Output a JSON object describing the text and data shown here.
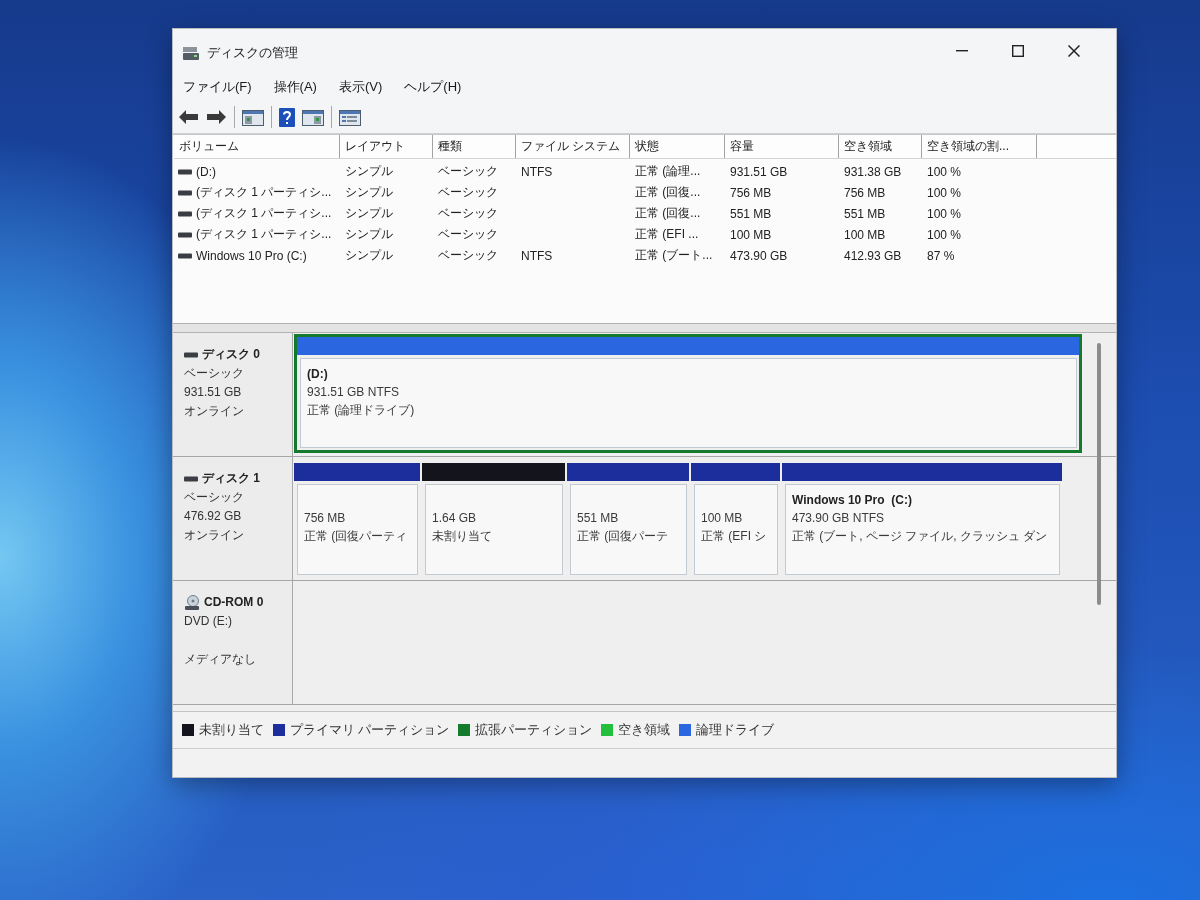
{
  "window": {
    "title": "ディスクの管理"
  },
  "menu": [
    {
      "label": "ファイル(F)"
    },
    {
      "label": "操作(A)"
    },
    {
      "label": "表示(V)"
    },
    {
      "label": "ヘルプ(H)"
    }
  ],
  "volume_table": {
    "columns": [
      "ボリューム",
      "レイアウト",
      "種類",
      "ファイル システム",
      "状態",
      "容量",
      "空き領域",
      "空き領域の割..."
    ],
    "rows": [
      {
        "volume": "(D:)",
        "layout": "シンプル",
        "type": "ベーシック",
        "file_system": "NTFS",
        "status": "正常 (論理...",
        "capacity": "931.51 GB",
        "free_space": "931.38 GB",
        "percent_free": "100 %"
      },
      {
        "volume": "(ディスク 1 パーティシ...",
        "layout": "シンプル",
        "type": "ベーシック",
        "status": "正常 (回復...",
        "capacity": "756 MB",
        "free_space": "756 MB",
        "percent_free": "100 %"
      },
      {
        "volume": "(ディスク 1 パーティシ...",
        "layout": "シンプル",
        "type": "ベーシック",
        "status": "正常 (回復...",
        "capacity": "551 MB",
        "free_space": "551 MB",
        "percent_free": "100 %"
      },
      {
        "volume": "(ディスク 1 パーティシ...",
        "layout": "シンプル",
        "type": "ベーシック",
        "status": "正常 (EFI ...",
        "capacity": "100 MB",
        "free_space": "100 MB",
        "percent_free": "100 %"
      },
      {
        "volume": "Windows 10 Pro (C:)",
        "layout": "シンプル",
        "type": "ベーシック",
        "file_system": "NTFS",
        "status": "正常 (ブート...",
        "capacity": "473.90 GB",
        "free_space": "412.93 GB",
        "percent_free": "87 %"
      }
    ]
  },
  "disks": [
    {
      "kind": "disk",
      "name": "ディスク 0",
      "type": "ベーシック",
      "size": "931.51 GB",
      "status": "オンライン",
      "partitions": [
        {
          "kind": "extended",
          "partitions": [
            {
              "kind": "logical",
              "label": "(D:)",
              "size": "931.51 GB NTFS",
              "status": "正常 (論理ドライブ)"
            }
          ]
        }
      ]
    },
    {
      "kind": "disk",
      "name": "ディスク 1",
      "type": "ベーシック",
      "size": "476.92 GB",
      "status": "オンライン",
      "partitions": [
        {
          "kind": "primary",
          "size": "756 MB",
          "status": "正常 (回復パーティ"
        },
        {
          "kind": "unallocated",
          "size": "1.64 GB",
          "status": "未割り当て"
        },
        {
          "kind": "primary",
          "size": "551 MB",
          "status": "正常 (回復パーテ"
        },
        {
          "kind": "primary",
          "size": "100 MB",
          "status": "正常 (EFI シ"
        },
        {
          "kind": "primary",
          "label": "Windows 10 Pro  (C:)",
          "size": "473.90 GB NTFS",
          "status": "正常 (ブート, ページ ファイル, クラッシュ ダン"
        }
      ]
    },
    {
      "kind": "cdrom",
      "name": "CD-ROM 0",
      "type": "DVD (E:)",
      "status": "メディアなし"
    }
  ],
  "legend": [
    {
      "kind": "unallocated",
      "label": "未割り当て",
      "color": "#14141c"
    },
    {
      "kind": "primary",
      "label": "プライマリ パーティション",
      "color": "#1c2e9c"
    },
    {
      "kind": "extended",
      "label": "拡張パーティション",
      "color": "#137a2e"
    },
    {
      "kind": "free",
      "label": "空き領域",
      "color": "#22c03c"
    },
    {
      "kind": "logical",
      "label": "論理ドライブ",
      "color": "#2a66e0"
    }
  ]
}
